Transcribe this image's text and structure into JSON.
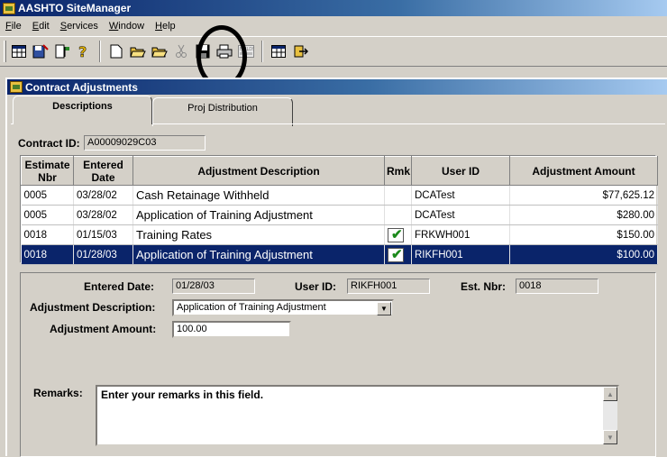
{
  "app": {
    "title": "AASHTO SiteManager"
  },
  "menu": [
    {
      "accel": "F",
      "rest": "ile"
    },
    {
      "accel": "E",
      "rest": "dit"
    },
    {
      "accel": "S",
      "rest": "ervices"
    },
    {
      "accel": "W",
      "rest": "indow"
    },
    {
      "accel": "H",
      "rest": "elp"
    }
  ],
  "toolbar_icons": [
    "grid-icon",
    "save-exit-icon",
    "document-flag-icon",
    "help-icon",
    "new-icon",
    "open-icon",
    "open-folder-icon",
    "cut-icon",
    "save-icon",
    "print-icon",
    "fields-icon",
    "calendar-icon",
    "exit-icon"
  ],
  "window": {
    "title": "Contract Adjustments"
  },
  "tabs": {
    "active": "Descriptions",
    "inactive": "Proj Distribution"
  },
  "contract": {
    "label": "Contract ID:",
    "value": "A00009029C03"
  },
  "table": {
    "headers": {
      "estimate_nbr": "Estimate Nbr",
      "entered_date": "Entered Date",
      "adjustment_description": "Adjustment Description",
      "rmk": "Rmk",
      "user_id": "User ID",
      "adjustment_amount": "Adjustment Amount"
    },
    "rows": [
      {
        "est": "0005",
        "date": "03/28/02",
        "desc": "Cash Retainage Withheld",
        "rmk": false,
        "user": "DCATest",
        "amount": "$77,625.12",
        "selected": false
      },
      {
        "est": "0005",
        "date": "03/28/02",
        "desc": "Application of Training Adjustment",
        "rmk": false,
        "user": "DCATest",
        "amount": "$280.00",
        "selected": false
      },
      {
        "est": "0018",
        "date": "01/15/03",
        "desc": "Training Rates",
        "rmk": true,
        "user": "FRKWH001",
        "amount": "$150.00",
        "selected": false
      },
      {
        "est": "0018",
        "date": "01/28/03",
        "desc": "Application of Training Adjustment",
        "rmk": true,
        "user": "RIKFH001",
        "amount": "$100.00",
        "selected": true
      }
    ]
  },
  "detail": {
    "entered_date_label": "Entered Date:",
    "entered_date": "01/28/03",
    "user_id_label": "User ID:",
    "user_id": "RIKFH001",
    "est_nbr_label": "Est. Nbr:",
    "est_nbr": "0018",
    "adj_desc_label": "Adjustment Description:",
    "adj_desc": "Application of Training Adjustment",
    "adj_amount_label": "Adjustment Amount:",
    "adj_amount": "100.00",
    "remarks_label": "Remarks:",
    "remarks_text": "Enter your remarks in this field."
  }
}
